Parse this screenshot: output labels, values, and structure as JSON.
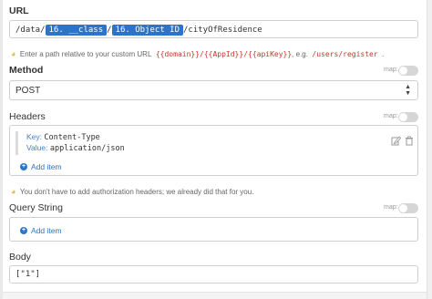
{
  "url": {
    "label": "URL",
    "segments": [
      "/data/",
      "16. __class",
      "/",
      "16. Object ID",
      "/cityOfResidence"
    ],
    "hint_prefix": "Enter a path relative to your custom URL",
    "hint_code1": "{{domain}}/{{AppId}}/{{apiKey}}",
    "hint_mid": ", e.g.",
    "hint_code2": "/users/register",
    "hint_suffix": "."
  },
  "method": {
    "label": "Method",
    "map_label": "map:",
    "value": "POST"
  },
  "headers": {
    "label": "Headers",
    "map_label": "map:",
    "items": [
      {
        "key_label": "Key:",
        "key": "Content-Type",
        "value_label": "Value:",
        "value": "application/json"
      }
    ],
    "add_label": "Add item",
    "hint": "You don't have to add authorization headers; we already did that for you."
  },
  "query": {
    "label": "Query String",
    "map_label": "map:",
    "add_label": "Add item"
  },
  "body": {
    "label": "Body",
    "value": "[\"1\"]"
  },
  "icons": {
    "bulb": "lightbulb-icon",
    "select": "select-arrows-icon",
    "edit": "pencil-icon",
    "delete": "trash-icon",
    "add": "plus-circle-icon"
  }
}
